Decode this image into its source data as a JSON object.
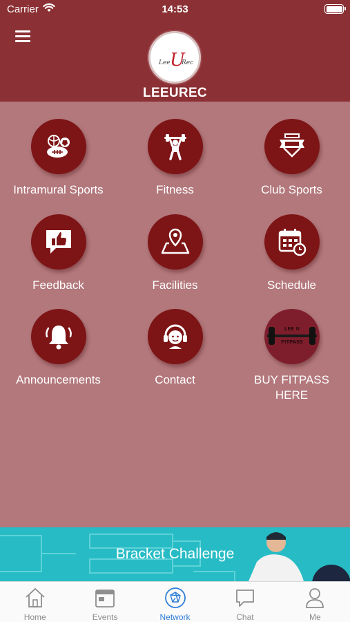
{
  "status_bar": {
    "carrier": "Carrier",
    "time": "14:53"
  },
  "header": {
    "title": "LEEUREC",
    "menu_icon": "hamburger-menu-icon",
    "logo_text": "LeeURec"
  },
  "tiles": [
    {
      "label": "Intramural Sports",
      "icon": "sports-balls-icon"
    },
    {
      "label": "Fitness",
      "icon": "weightlifter-icon"
    },
    {
      "label": "Club Sports",
      "icon": "banner-ribbon-icon"
    },
    {
      "label": "Feedback",
      "icon": "thumbs-up-speech-bubble-icon"
    },
    {
      "label": "Facilities",
      "icon": "map-pin-icon"
    },
    {
      "label": "Schedule",
      "icon": "calendar-clock-icon"
    },
    {
      "label": "Announcements",
      "icon": "bell-icon"
    },
    {
      "label": "Contact",
      "icon": "headset-person-icon"
    },
    {
      "label": "BUY FITPASS HERE",
      "icon": "fitpass-barbell-image",
      "image_text": "LEE U FITPASS"
    }
  ],
  "banner": {
    "text": "Bracket Challenge"
  },
  "tab_bar": {
    "active": "Network",
    "tabs": [
      {
        "label": "Home",
        "icon": "home-icon"
      },
      {
        "label": "Events",
        "icon": "calendar-icon"
      },
      {
        "label": "Network",
        "icon": "network-globe-icon"
      },
      {
        "label": "Chat",
        "icon": "chat-bubble-icon"
      },
      {
        "label": "Me",
        "icon": "person-icon"
      }
    ]
  },
  "colors": {
    "header_bg": "#8b3034",
    "main_bg": "#b3787c",
    "tile_circle": "#7d1416",
    "banner_bg": "#27bcc5",
    "tab_active": "#2f7ed8",
    "tab_inactive": "#8e8e8e"
  }
}
